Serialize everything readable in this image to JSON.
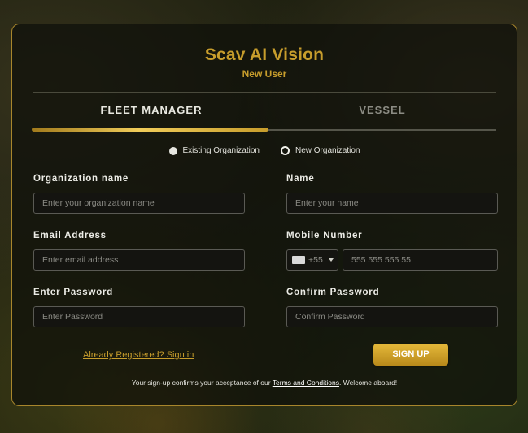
{
  "header": {
    "app_title": "Scav AI  Vision",
    "subtitle": "New User"
  },
  "tabs": [
    {
      "label": "FLEET MANAGER",
      "active": true
    },
    {
      "label": "VESSEL",
      "active": false
    }
  ],
  "org_mode": {
    "options": [
      {
        "label": "Existing Organization",
        "selected": true
      },
      {
        "label": "New Organization",
        "selected": false
      }
    ]
  },
  "form": {
    "org_name": {
      "label": "Organization name",
      "placeholder": "Enter your organization name",
      "value": ""
    },
    "name": {
      "label": "Name",
      "placeholder": "Enter your name",
      "value": ""
    },
    "email": {
      "label": "Email Address",
      "placeholder": "Enter email address",
      "value": ""
    },
    "mobile": {
      "label": "Mobile Number",
      "country_code": "+55",
      "placeholder": "555 555 555 55",
      "value": ""
    },
    "password": {
      "label": "Enter Password",
      "placeholder": "Enter Password",
      "value": ""
    },
    "confirm_password": {
      "label": "Confirm Password",
      "placeholder": "Confirm Password",
      "value": ""
    }
  },
  "actions": {
    "signin_link": "Already Registered? Sign in",
    "signup_button": "SIGN UP"
  },
  "footer": {
    "text_before": "Your sign-up confirms your acceptance of our ",
    "terms_link": "Terms and Conditions",
    "text_after": ". Welcome aboard!"
  },
  "colors": {
    "accent": "#c79d2c",
    "card_border": "#a8862c",
    "button": "#d4a52a"
  }
}
